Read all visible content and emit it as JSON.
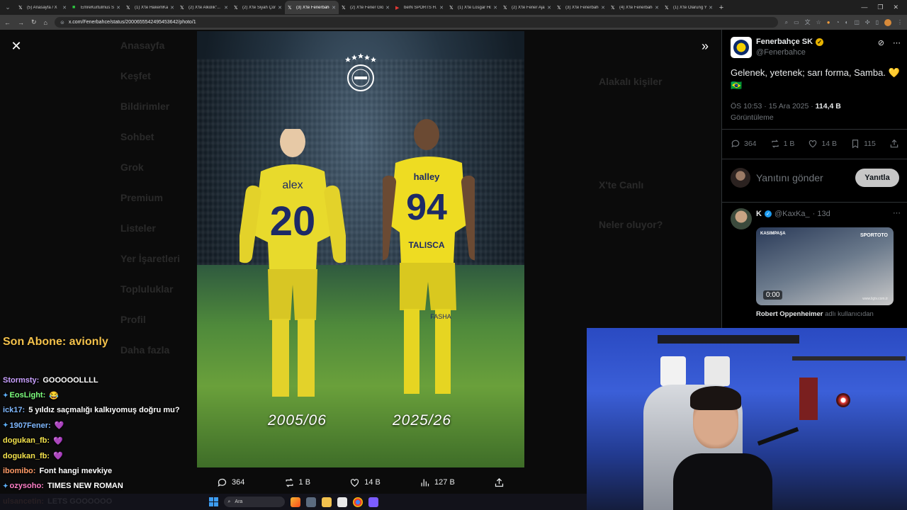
{
  "browser": {
    "tabs": [
      {
        "label": "(5) Anasayfa / X",
        "icon": "x-icon",
        "active": false
      },
      {
        "label": "EmreKurtulmus Str...",
        "icon": "kick-icon",
        "active": false
      },
      {
        "label": "(1) X'te HakemKara...",
        "icon": "x-icon",
        "active": false
      },
      {
        "label": "(2) X'te Alkolik\"...",
        "icon": "x-icon",
        "active": false
      },
      {
        "label": "(2) X'te Siyah Çorap...",
        "icon": "x-icon",
        "active": false
      },
      {
        "label": "(3) X'te Fenerbahçe...",
        "icon": "x-icon",
        "active": true
      },
      {
        "label": "(2) X'te Fener Glob...",
        "icon": "x-icon",
        "active": false
      },
      {
        "label": "beIN SPORTS H...",
        "icon": "youtube-icon",
        "active": false
      },
      {
        "label": "(1) X'te Losgar Hoo...",
        "icon": "x-icon",
        "active": false
      },
      {
        "label": "(2) X'te Fener Ajan...",
        "icon": "x-icon",
        "active": false
      },
      {
        "label": "(3) X'te Fenerbahçe...",
        "icon": "x-icon",
        "active": false
      },
      {
        "label": "(4) X'te Fenerbahçe...",
        "icon": "x-icon",
        "active": false
      },
      {
        "label": "(1) X'te Olarung Yo...",
        "icon": "x-icon",
        "active": false
      }
    ],
    "url": "x.com/Fenerbahce/status/2000655542495453642/photo/1"
  },
  "background_page": {
    "sidebar": [
      "Anasayfa",
      "Keşfet",
      "Bildirimler",
      "Sohbet",
      "Grok",
      "Premium",
      "Listeler",
      "Yer İşaretleri",
      "Topluluklar",
      "Profil",
      "Daha fazla"
    ],
    "right_headings": [
      "Alakalı kişiler",
      "X'te Canlı",
      "Neler oluyor?"
    ]
  },
  "photo": {
    "years": [
      "2005/06",
      "2025/26"
    ],
    "left_player": {
      "name": "alex",
      "number": "20"
    },
    "right_player": {
      "name": "TALISCA",
      "number": "94",
      "sponsor": "halley",
      "brand": "FASHA"
    }
  },
  "viewer_actions": {
    "replies": "364",
    "reposts": "1 B",
    "likes": "14 B",
    "views": "127 B"
  },
  "tweet": {
    "author": "Fenerbahçe SK",
    "handle": "@Fenerbahce",
    "text": "Gelenek, yetenek; sarı forma, Samba. 💛🇧🇷",
    "time": "ÖS 10:53 · 15 Ara 2025 ·",
    "views_count": "114,4 B",
    "views_label": "Görüntüleme",
    "stats": {
      "replies": "364",
      "reposts": "1 B",
      "likes": "14 B",
      "bookmarks": "115"
    },
    "reply_placeholder": "Yanıtını gönder",
    "reply_button": "Yanıtla"
  },
  "reply": {
    "name": "K",
    "handle": "@KaxKa_",
    "age": "· 13d",
    "video_time": "0:00",
    "video_logo": "SPORTOTO",
    "video_corner": "KASIMPAŞA",
    "video_watermark": "www.ligtv.com.tr",
    "caption_name": "Robert Oppenheimer",
    "caption_rest": "adlı kullanıcıdan"
  },
  "chat": {
    "title": "Son Abone: avionly",
    "messages": [
      {
        "user": "Stormsty:",
        "text": "GOOOOOLLLL",
        "color": "#c9a0ff",
        "badge": false
      },
      {
        "user": "EosLight:",
        "text": "😂",
        "color": "#7dff7d",
        "badge": true
      },
      {
        "user": "ick17:",
        "text": "5 yıldız saçmalığı kalkıyomuş doğru mu?",
        "color": "#7fb8ff",
        "badge": false
      },
      {
        "user": "1907Fener:",
        "text": "💜",
        "color": "#7fb8ff",
        "badge": true
      },
      {
        "user": "dogukan_fb:",
        "text": "💜",
        "color": "#f3e24b",
        "badge": false
      },
      {
        "user": "dogukan_fb:",
        "text": "💜",
        "color": "#f3e24b",
        "badge": false
      },
      {
        "user": "ibomibo:",
        "text": "Font hangi mevkiye",
        "color": "#ff9a66",
        "badge": false
      },
      {
        "user": "ozysoho:",
        "text": "TIMES NEW ROMAN",
        "color": "#ff7fc7",
        "badge": true
      },
      {
        "user": "ulsancetin:",
        "text": "LETS GOOOOOO",
        "color": "#ff9a66",
        "badge": false
      }
    ]
  },
  "taskbar": {
    "search_placeholder": "Ara"
  },
  "colors": {
    "accent_blue": "#1d9bf0",
    "fener_yellow": "#f5d100",
    "fener_navy": "#0b2a6b",
    "chat_title": "#f3c14b"
  }
}
